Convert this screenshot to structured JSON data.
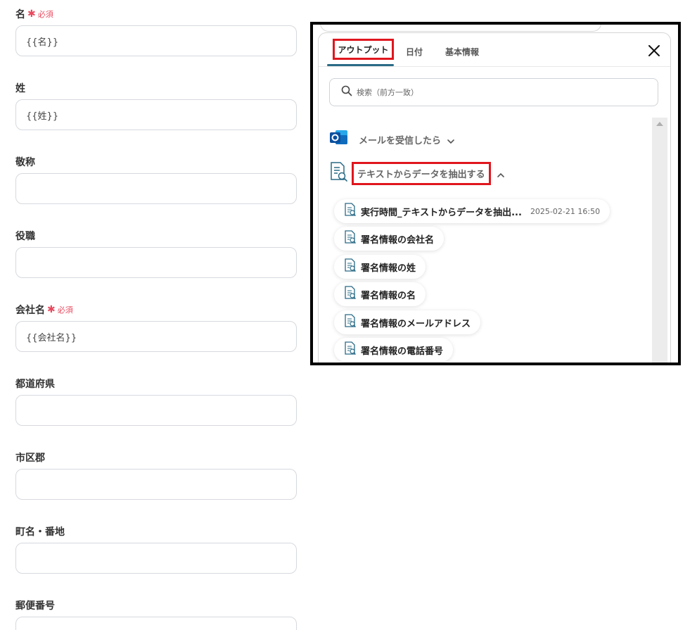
{
  "form": {
    "required_text": "必須",
    "fields": [
      {
        "label": "名",
        "required": true,
        "value": "{{名}}"
      },
      {
        "label": "姓",
        "required": false,
        "value": "{{姓}}"
      },
      {
        "label": "敬称",
        "required": false,
        "value": ""
      },
      {
        "label": "役職",
        "required": false,
        "value": ""
      },
      {
        "label": "会社名",
        "required": true,
        "value": "{{会社名}}"
      },
      {
        "label": "都道府県",
        "required": false,
        "value": ""
      },
      {
        "label": "市区郡",
        "required": false,
        "value": ""
      },
      {
        "label": "町名・番地",
        "required": false,
        "value": ""
      },
      {
        "label": "郵便番号",
        "required": false,
        "value": ""
      }
    ]
  },
  "popup": {
    "tabs": [
      "アウトプット",
      "日付",
      "基本情報"
    ],
    "active_tab": "アウトプット",
    "search_placeholder": "検索（前方一致）",
    "sections": [
      {
        "title": "メールを受信したら",
        "icon": "outlook-icon",
        "expanded": false
      },
      {
        "title": "テキストからデータを抽出する",
        "icon": "text-extract-icon",
        "expanded": true
      }
    ],
    "items": [
      {
        "label": "実行時間_テキストからデータを抽出...",
        "value": "2025-02-21 16:50"
      },
      {
        "label": "署名情報の会社名",
        "value": ""
      },
      {
        "label": "署名情報の姓",
        "value": ""
      },
      {
        "label": "署名情報の名",
        "value": ""
      },
      {
        "label": "署名情報のメールアドレス",
        "value": ""
      },
      {
        "label": "署名情報の電話番号",
        "value": ""
      }
    ]
  },
  "colors": {
    "required": "#e84a5f",
    "highlight_box": "#e0161e",
    "tab_underline": "#2a6b86",
    "outlook_blue": "#0f6cbd",
    "doc_icon": "#2a6b86"
  }
}
